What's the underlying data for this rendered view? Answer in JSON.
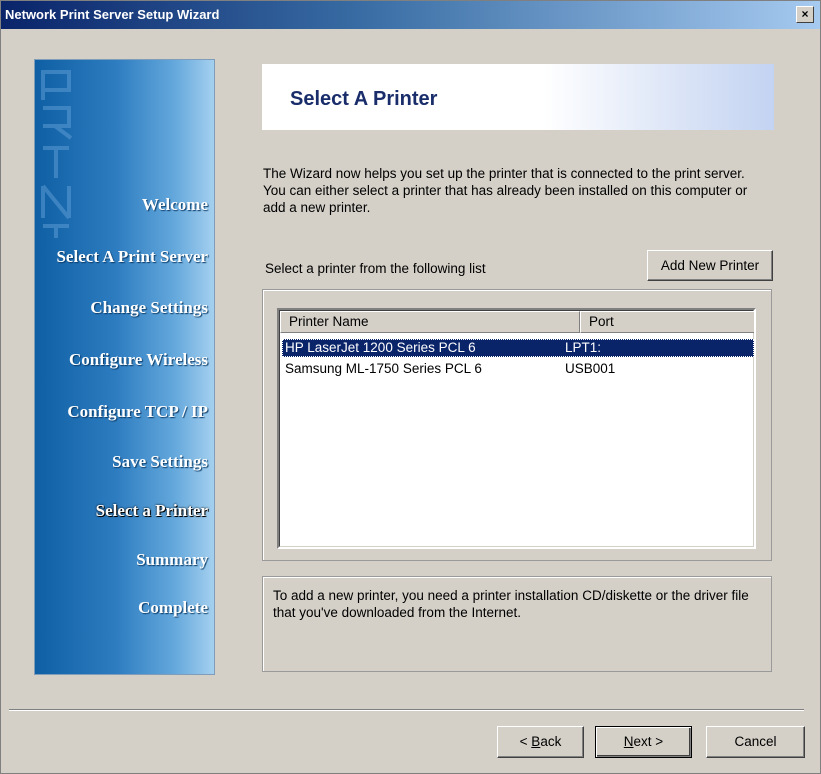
{
  "window": {
    "title": "Network Print Server Setup Wizard",
    "close_glyph": "×"
  },
  "sidebar": {
    "watermark_text": "PRINT",
    "items": [
      {
        "label": "Welcome"
      },
      {
        "label": "Select A Print Server"
      },
      {
        "label": "Change Settings"
      },
      {
        "label": "Configure Wireless"
      },
      {
        "label": "Configure TCP / IP"
      },
      {
        "label": "Save Settings"
      },
      {
        "label": "Select a Printer",
        "active": true
      },
      {
        "label": "Summary"
      },
      {
        "label": "Complete"
      }
    ]
  },
  "header": {
    "title": "Select A Printer"
  },
  "description": "The Wizard now helps you set up the printer that is connected to the print server. You can either select a printer that has already been installed on this computer or add a new printer.",
  "printer_select": {
    "label": "Select a printer from the following list",
    "add_button": "Add New Printer",
    "columns": [
      "Printer Name",
      "Port"
    ],
    "rows": [
      {
        "name": "HP LaserJet 1200 Series PCL 6",
        "port": "LPT1:",
        "selected": true
      },
      {
        "name": "Samsung ML-1750 Series PCL 6",
        "port": "USB001",
        "selected": false
      }
    ]
  },
  "info": "To add a new printer, you need a printer installation CD/diskette or the driver file that you've downloaded from the Internet.",
  "buttons": {
    "back_prefix": "< ",
    "back_key": "B",
    "back_rest": "ack",
    "next_key": "N",
    "next_rest": "ext >",
    "cancel": "Cancel"
  },
  "colors": {
    "accent": "#0a246a",
    "header_title": "#1a2d6b",
    "sidebar": "#2d7cc0"
  }
}
